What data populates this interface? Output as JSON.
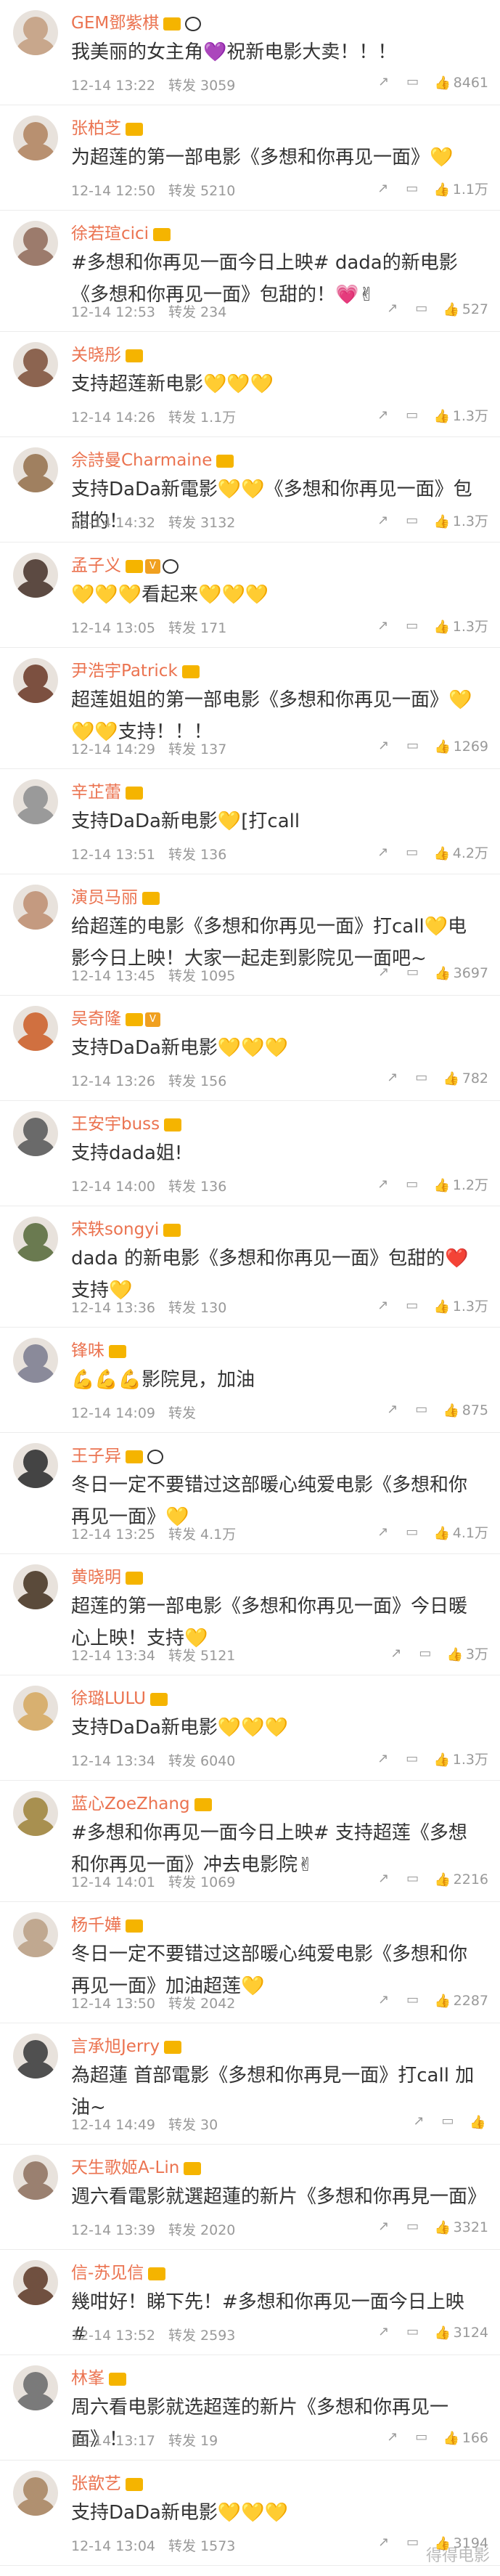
{
  "page": {
    "watermark": "得得电影"
  },
  "labels": {
    "forward": "转发"
  },
  "comments": [
    {
      "user": "GEM鄧紫棋",
      "crown": true,
      "vip": false,
      "panda": true,
      "text": "我美丽的女主角💜祝新电影大卖！！！",
      "time": "12-14 13:22",
      "forwards": "3059",
      "likes": "8461",
      "avatar": "#c8a78c"
    },
    {
      "user": "张柏芝",
      "crown": true,
      "vip": false,
      "panda": false,
      "text": "为超莲的第一部电影《多想和你再见一面》💛",
      "time": "12-14 12:50",
      "forwards": "5210",
      "likes": "1.1万",
      "avatar": "#b89070"
    },
    {
      "user": "徐若瑄cici",
      "crown": true,
      "vip": false,
      "panda": false,
      "text": "#多想和你再见一面今日上映# dada的新电影《多想和你再见一面》包甜的！💗✌",
      "time": "12-14 12:53",
      "forwards": "234",
      "likes": "527",
      "avatar": "#9c7b6c"
    },
    {
      "user": "关晓彤",
      "crown": true,
      "vip": false,
      "panda": false,
      "text": "支持超莲新电影💛💛💛",
      "time": "12-14 14:26",
      "forwards": "1.1万",
      "likes": "1.3万",
      "avatar": "#8c6450"
    },
    {
      "user": "佘詩曼Charmaine",
      "crown": true,
      "vip": false,
      "panda": false,
      "text": "支持DaDa新電影💛💛《多想和你再见一面》包甜的！",
      "time": "12-14 14:32",
      "forwards": "3132",
      "likes": "1.3万",
      "avatar": "#a08060"
    },
    {
      "user": "孟子义",
      "crown": true,
      "vip": true,
      "panda": true,
      "text": "💛💛💛看起来💛💛💛",
      "time": "12-14 13:05",
      "forwards": "171",
      "likes": "1.3万",
      "avatar": "#5c4a42"
    },
    {
      "user": "尹浩宇Patrick",
      "crown": true,
      "vip": false,
      "panda": false,
      "text": "超莲姐姐的第一部电影《多想和你再见一面》💛💛💛支持！！！",
      "time": "12-14 14:29",
      "forwards": "137",
      "likes": "1269",
      "avatar": "#7c5040"
    },
    {
      "user": "辛芷蕾",
      "crown": true,
      "vip": false,
      "panda": false,
      "text": "支持DaDa新电影💛[打call",
      "time": "12-14 13:51",
      "forwards": "136",
      "likes": "4.2万",
      "avatar": "#9a9a9a"
    },
    {
      "user": "演员马丽",
      "crown": true,
      "vip": false,
      "panda": false,
      "text": "给超莲的电影《多想和你再见一面》打call💛电影今日上映！大家一起走到影院见一面吧~",
      "time": "12-14 13:45",
      "forwards": "1095",
      "likes": "3697",
      "avatar": "#c49a80"
    },
    {
      "user": "吴奇隆",
      "crown": true,
      "vip": true,
      "panda": false,
      "text": "支持DaDa新电影💛💛💛",
      "time": "12-14 13:26",
      "forwards": "156",
      "likes": "782",
      "avatar": "#d07040"
    },
    {
      "user": "王安宇buss",
      "crown": true,
      "vip": false,
      "panda": false,
      "text": "支持dada姐!",
      "time": "12-14 14:00",
      "forwards": "136",
      "likes": "1.2万",
      "avatar": "#6a6a6a"
    },
    {
      "user": "宋轶songyi",
      "crown": true,
      "vip": false,
      "panda": false,
      "text": "dada 的新电影《多想和你再见一面》包甜的❤️支持💛",
      "time": "12-14 13:36",
      "forwards": "130",
      "likes": "1.3万",
      "avatar": "#6a7a50"
    },
    {
      "user": "锋味",
      "crown": true,
      "vip": false,
      "panda": false,
      "text": "💪💪💪影院見，加油",
      "time": "12-14 14:09",
      "forwards": "",
      "likes": "875",
      "avatar": "#8a8a9a"
    },
    {
      "user": "王子异",
      "crown": true,
      "vip": false,
      "panda": true,
      "text": "冬日一定不要错过这部暖心纯爱电影《多想和你再见一面》💛",
      "time": "12-14 13:25",
      "forwards": "4.1万",
      "likes": "4.1万",
      "avatar": "#444444"
    },
    {
      "user": "黄晓明",
      "crown": true,
      "vip": false,
      "panda": false,
      "text": "超莲的第一部电影《多想和你再见一面》今日暖心上映！支持💛",
      "time": "12-14 13:34",
      "forwards": "5121",
      "likes": "3万",
      "avatar": "#5a4a3a"
    },
    {
      "user": "徐璐LULU",
      "crown": true,
      "vip": false,
      "panda": false,
      "text": "支持DaDa新电影💛💛💛",
      "time": "12-14 13:34",
      "forwards": "6040",
      "likes": "1.3万",
      "avatar": "#d8b070"
    },
    {
      "user": "蓝心ZoeZhang",
      "crown": true,
      "vip": false,
      "panda": false,
      "text": "#多想和你再见一面今日上映# 支持超莲《多想和你再见一面》冲去电影院✌",
      "time": "12-14 14:01",
      "forwards": "1069",
      "likes": "2216",
      "avatar": "#a89050"
    },
    {
      "user": "杨千嬅",
      "crown": true,
      "vip": false,
      "panda": false,
      "text": "冬日一定不要错过这部暖心纯爱电影《多想和你再见一面》加油超莲💛",
      "time": "12-14 13:50",
      "forwards": "2042",
      "likes": "2287",
      "avatar": "#c0a890"
    },
    {
      "user": "言承旭Jerry",
      "crown": true,
      "vip": false,
      "panda": false,
      "text": "為超蓮 首部電影《多想和你再見一面》打call 加油~",
      "time": "12-14 14:49",
      "forwards": "30",
      "likes": "",
      "avatar": "#505050"
    },
    {
      "user": "天生歌姬A-Lin",
      "crown": true,
      "vip": false,
      "panda": false,
      "text": "週六看電影就選超蓮的新片《多想和你再見一面》",
      "time": "12-14 13:39",
      "forwards": "2020",
      "likes": "3321",
      "avatar": "#9a8070"
    },
    {
      "user": "信-苏见信",
      "crown": true,
      "vip": false,
      "panda": false,
      "text": "幾咁好！睇下先！#多想和你再见一面今日上映#",
      "time": "12-14 13:52",
      "forwards": "2593",
      "likes": "3124",
      "avatar": "#705040"
    },
    {
      "user": "林峯",
      "crown": true,
      "vip": false,
      "panda": false,
      "text": "周六看电影就选超莲的新片《多想和你再见一面》！",
      "time": "12-14 13:17",
      "forwards": "19",
      "likes": "166",
      "avatar": "#7a7a7a"
    },
    {
      "user": "张歆艺",
      "crown": true,
      "vip": false,
      "panda": false,
      "text": "支持DaDa新电影💛💛💛",
      "time": "12-14 13:04",
      "forwards": "1573",
      "likes": "3194",
      "avatar": "#b09070"
    }
  ]
}
